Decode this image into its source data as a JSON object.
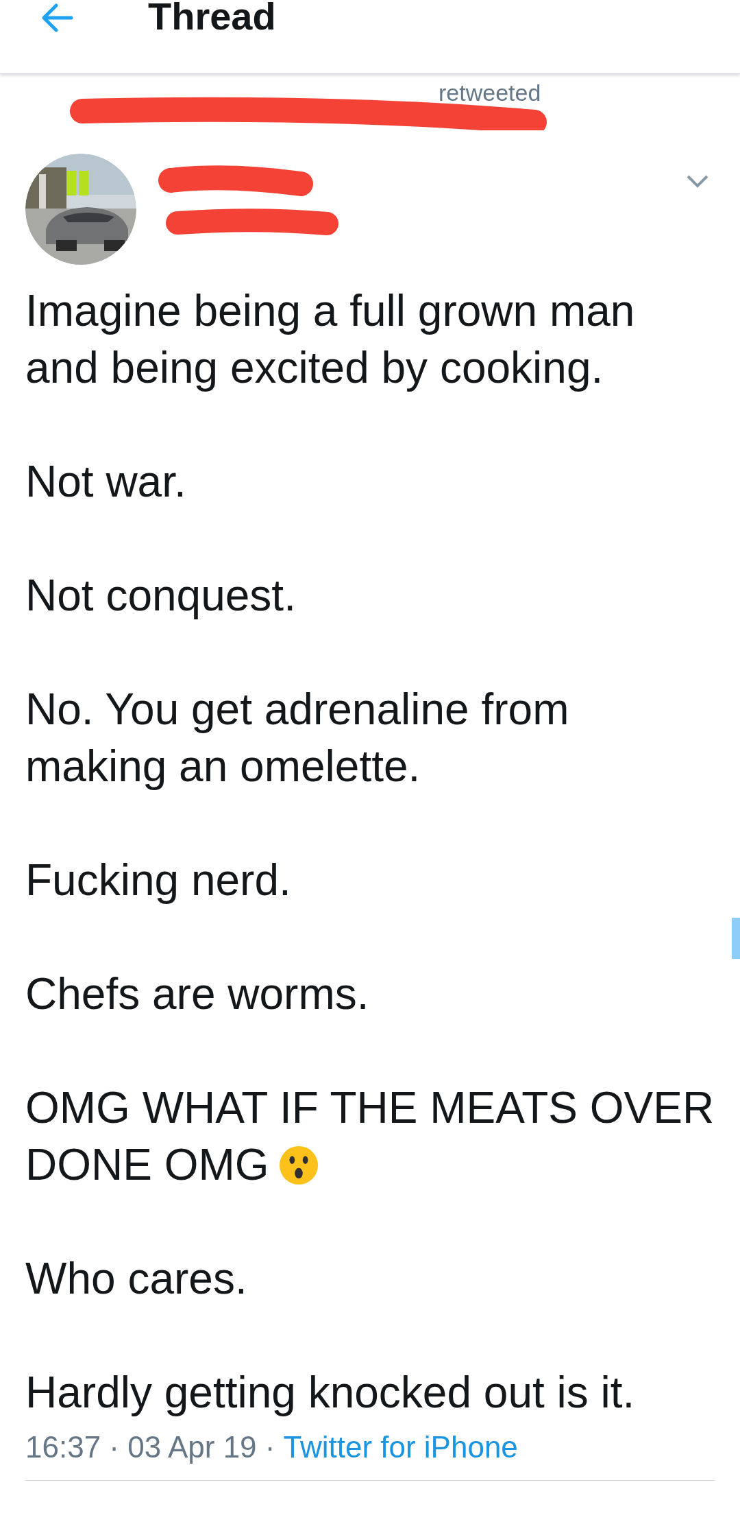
{
  "header": {
    "title": "Thread"
  },
  "retweet_label": "retweeted",
  "tweet": {
    "paragraphs": [
      "Imagine being a full grown man and being excited by cooking.",
      "Not war.",
      "Not conquest.",
      "No. You get adrenaline from making an omelette.",
      "Fucking nerd.",
      "Chefs are worms.",
      "OMG WHAT IF THE MEATS OVER",
      {
        "text": "DONE OMG",
        "continues": true,
        "emoji": true
      },
      "Who cares.",
      "Hardly getting knocked out is it."
    ],
    "timestamp": "16:37 · 03 Apr 19 ·",
    "source": "Twitter for iPhone"
  }
}
